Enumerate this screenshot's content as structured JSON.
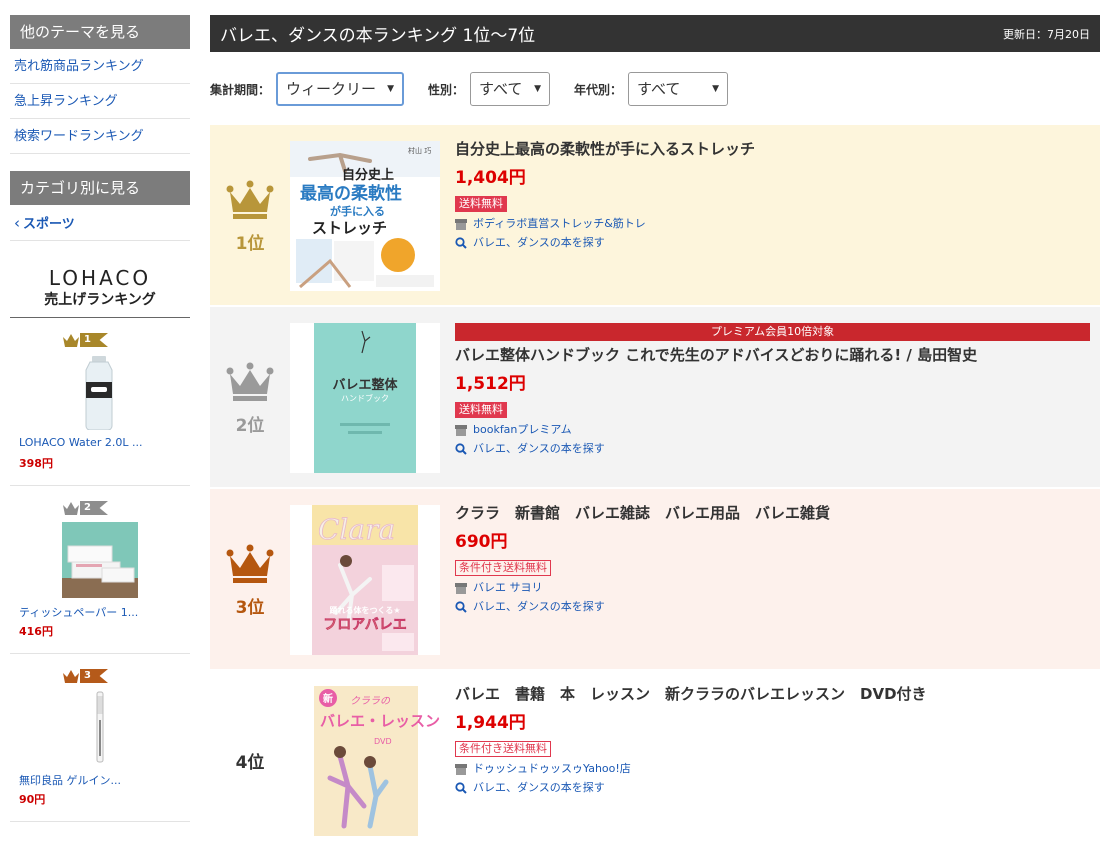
{
  "sidebar": {
    "theme_heading": "他のテーマを見る",
    "theme_links": [
      "売れ筋商品ランキング",
      "急上昇ランキング",
      "検索ワードランキング"
    ],
    "category_heading": "カテゴリ別に見る",
    "category_back": "スポーツ",
    "lohaco": {
      "logo": "LOHACO",
      "subtitle": "売上げランキング",
      "items": [
        {
          "rank": "1",
          "name": "LOHACO Water 2.0L ...",
          "price": "398円",
          "badge_color": "#a8872a"
        },
        {
          "rank": "2",
          "name": "ティッシュペーパー 1...",
          "price": "416円",
          "badge_color": "#8e8e8e"
        },
        {
          "rank": "3",
          "name": "無印良品 ゲルイン...",
          "price": "90円",
          "badge_color": "#b55a1a"
        }
      ]
    }
  },
  "main": {
    "title": "バレエ、ダンスの本ランキング 1位〜7位",
    "updated": "更新日：7月20日",
    "filters": {
      "period_label": "集計期間：",
      "period_value": "ウィークリー",
      "gender_label": "性別：",
      "gender_value": "すべて",
      "age_label": "年代別：",
      "age_value": "すべて"
    },
    "items": [
      {
        "rank": "1位",
        "name": "自分史上最高の柔軟性が手に入るストレッチ",
        "price": "1,404円",
        "shipping": "送料無料",
        "store": "ボディラボ直営ストレッチ&筋トレ",
        "search": "バレエ、ダンスの本を探す",
        "bg": "#fdf5dc",
        "crown_color": "#b8963a",
        "cover": {
          "author": "村山 巧",
          "line1": "自分史上",
          "line2": "最高の柔軟性",
          "line3": "が手に入る",
          "line4": "ストレッチ"
        }
      },
      {
        "rank": "2位",
        "premium": "プレミアム会員10倍対象",
        "name": "バレエ整体ハンドブック これで先生のアドバイスどおりに踊れる! / 島田智史",
        "price": "1,512円",
        "shipping": "送料無料",
        "store": "bookfanプレミアム",
        "search": "バレエ、ダンスの本を探す",
        "bg": "#f3f3f3",
        "crown_color": "#9a9a9a",
        "cover": {
          "title": "バレエ整体",
          "sub": "ハンドブック"
        }
      },
      {
        "rank": "3位",
        "name": "クララ　新書館　バレエ雑誌　バレエ用品　バレエ雑貨",
        "price": "690円",
        "shipping": "条件付き送料無料",
        "store": "バレエ サヨリ",
        "search": "バレエ、ダンスの本を探す",
        "bg": "#fdf1ec",
        "crown_color": "#b5570f",
        "cover": {
          "logo": "Clara",
          "caption": "踊れる体をつくる★",
          "headline": "フロアバレエ"
        }
      },
      {
        "rank": "4位",
        "name": "バレエ　書籍　本　レッスン　新クララのバレエレッスン　DVD付き",
        "price": "1,944円",
        "shipping": "条件付き送料無料",
        "store": "ドゥッシュドゥッスゥYahoo!店",
        "search": "バレエ、ダンスの本を探す",
        "bg": "#ffffff",
        "crown_color": "",
        "cover": {
          "new": "新",
          "title": "クララの",
          "title2": "バレエ・レッスン",
          "dvd": "DVD"
        }
      }
    ]
  }
}
